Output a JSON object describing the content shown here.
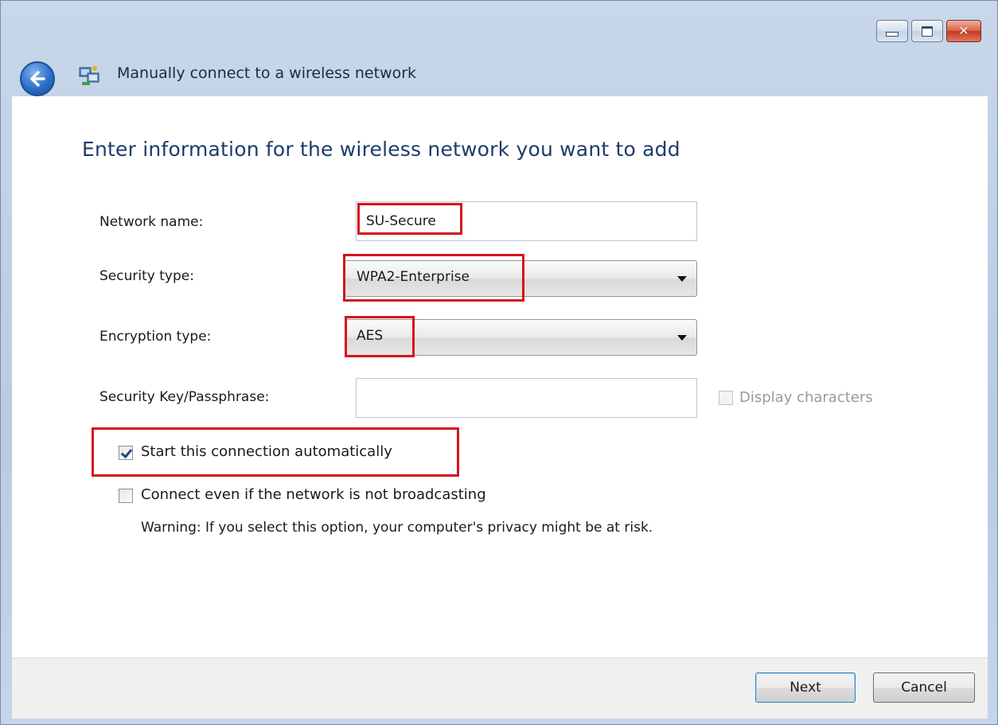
{
  "window": {
    "title": "Manually connect to a wireless network",
    "caption_buttons": [
      "minimize",
      "maximize",
      "close"
    ]
  },
  "heading": "Enter information for the wireless network you want to add",
  "form": {
    "network_name": {
      "label": "Network name:",
      "value": "SU-Secure"
    },
    "security_type": {
      "label": "Security type:",
      "value": "WPA2-Enterprise"
    },
    "encryption_type": {
      "label": "Encryption type:",
      "value": "AES"
    },
    "security_key": {
      "label": "Security Key/Passphrase:",
      "value": ""
    },
    "display_characters": {
      "label": "Display characters",
      "checked": false,
      "enabled": false
    },
    "start_automatically": {
      "label": "Start this connection automatically",
      "checked": true
    },
    "connect_not_broadcasting": {
      "label": "Connect even if the network is not broadcasting",
      "checked": false
    },
    "warning": "Warning: If you select this option, your computer's privacy might be at risk."
  },
  "buttons": {
    "next": "Next",
    "cancel": "Cancel"
  },
  "colors": {
    "highlight": "#d4141b",
    "heading": "#1f3b6b",
    "frame": "#b9cbe2"
  }
}
